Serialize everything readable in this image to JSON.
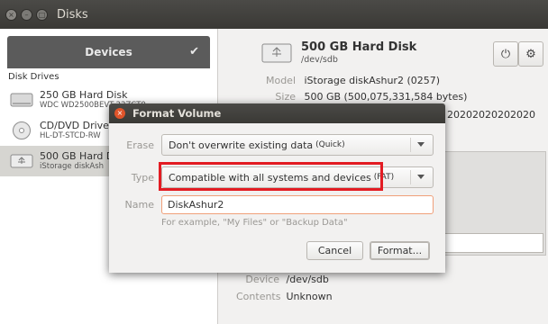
{
  "window": {
    "title": "Disks"
  },
  "sidebar": {
    "header": "Devices",
    "section_label": "Disk Drives",
    "drives": [
      {
        "name": "250 GB Hard Disk",
        "model": "WDC WD2500BEVT-22ZCT0"
      },
      {
        "name": "CD/DVD Drive",
        "model": "HL-DT-STCD-RW"
      },
      {
        "name": "500 GB Hard D",
        "model": "iStorage diskAsh"
      }
    ]
  },
  "disk": {
    "name": "500 GB Hard Disk",
    "device": "/dev/sdb",
    "model_label": "Model",
    "model_value": "iStorage diskAshur2 (0257)",
    "size_label": "Size",
    "size_value": "500 GB (500,075,331,584 bytes)",
    "serial_fragment": "20202020202020",
    "device_label": "Device",
    "device_value": "/dev/sdb",
    "contents_label": "Contents",
    "contents_value": "Unknown"
  },
  "dialog": {
    "title": "Format Volume",
    "erase_label": "Erase",
    "erase_value": "Don't overwrite existing data",
    "erase_suffix": "(Quick)",
    "type_label": "Type",
    "type_value": "Compatible with all systems and devices",
    "type_suffix": "(FAT)",
    "name_label": "Name",
    "name_value": "DiskAshur2",
    "name_hint": "For example, \"My Files\" or \"Backup Data\"",
    "cancel_label": "Cancel",
    "format_label": "Format..."
  },
  "colors": {
    "highlight": "#e31c23",
    "titlebar": "#3c3b37",
    "close_button": "#e0542a"
  }
}
